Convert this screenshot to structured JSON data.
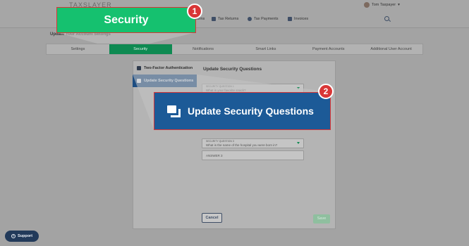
{
  "header": {
    "brand": "TAXSLAYER",
    "user_name": "Tom Taxpayer",
    "nav": [
      {
        "label": "Returns",
        "icon": "list-icon"
      },
      {
        "label": "Tax Returns",
        "icon": "document-icon"
      },
      {
        "label": "Tax Payments",
        "icon": "dollar-icon"
      },
      {
        "label": "Invoices",
        "icon": "invoice-icon"
      }
    ]
  },
  "settings_title": "Update Your Account Settings",
  "tabs": [
    "Settings",
    "Security",
    "Notifications",
    "Smart Links",
    "Payment Accounts",
    "Additional User Account"
  ],
  "active_tab": "Security",
  "sidebar": [
    {
      "label": "Two-Factor Authentication",
      "icon": "shield-icon",
      "active": false
    },
    {
      "label": "Update Security Questions",
      "icon": "chat-bubbles-icon",
      "active": true
    }
  ],
  "content_title": "Update Security Questions",
  "form": {
    "q1_label": "SECURITY QUESTION 1",
    "q1_value": "What is your favorite snack?",
    "q3_label": "SECURITY QUESTION 3",
    "q3_value": "What is the name of the hospital you were born in?",
    "a3_label": "ANSWER 3"
  },
  "buttons": {
    "cancel": "Cancel",
    "save": "Save",
    "support": "Support"
  },
  "callouts": {
    "one": {
      "number": "1",
      "label": "Security"
    },
    "two": {
      "number": "2",
      "label": "Update Security Questions"
    }
  },
  "colors": {
    "accent_green": "#15c16f",
    "accent_blue": "#1c5a97",
    "callout_border": "#d93636"
  }
}
